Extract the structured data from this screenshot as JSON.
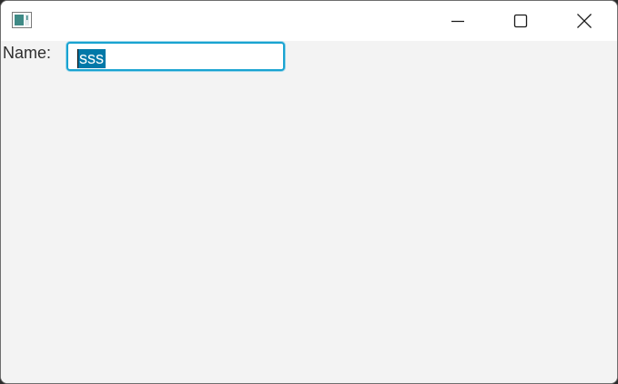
{
  "window": {
    "title": "",
    "controls": [
      "minimize",
      "maximize",
      "close"
    ]
  },
  "form": {
    "name_label": "Name:",
    "name_value": "sss"
  },
  "icons": {
    "app": "app-window-icon",
    "minimize": "minimize-icon",
    "maximize": "maximize-icon",
    "close": "close-icon"
  },
  "colors": {
    "focus_border": "#19a3d1",
    "selection": "#0078a8",
    "content_background": "#f3f3f3",
    "titlebar_background": "#ffffff"
  }
}
